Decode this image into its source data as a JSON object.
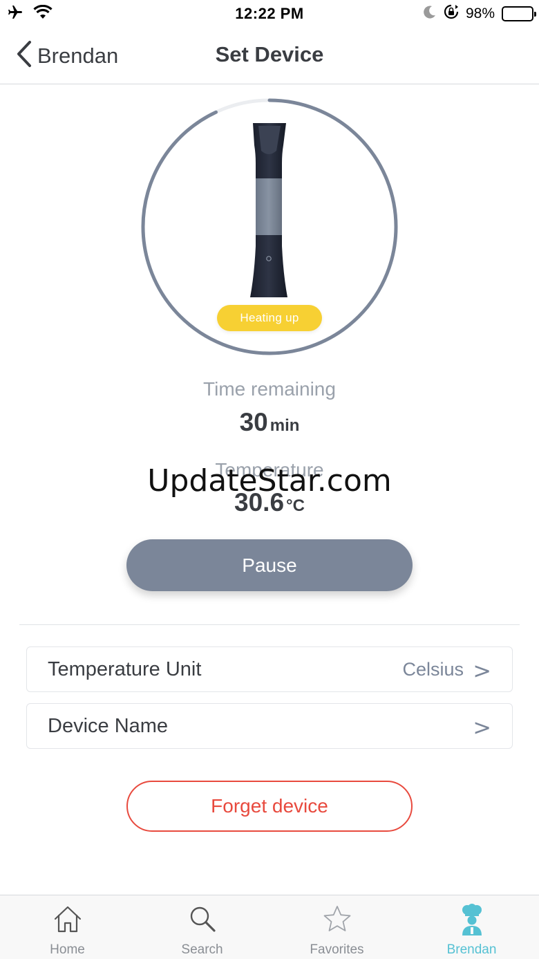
{
  "status_bar": {
    "time": "12:22 PM",
    "battery_percent": "98%",
    "icons": [
      "airplane-icon",
      "wifi-icon",
      "moon-icon",
      "rotation-lock-icon",
      "battery-icon"
    ]
  },
  "nav": {
    "back_label": "Brendan",
    "title": "Set Device"
  },
  "device": {
    "status_badge": "Heating up",
    "progress_fraction": 0.93
  },
  "stats": {
    "time_label": "Time remaining",
    "time_value": "30",
    "time_unit": "min",
    "temp_label": "Temperature",
    "temp_value": "30.6",
    "temp_unit": "°C"
  },
  "watermark": "UpdateStar.com",
  "actions": {
    "pause_label": "Pause",
    "forget_label": "Forget device"
  },
  "settings": [
    {
      "label": "Temperature Unit",
      "value": "Celsius",
      "chevron": ">"
    },
    {
      "label": "Device Name",
      "value": "",
      "chevron": ">"
    }
  ],
  "tabs": [
    {
      "label": "Home",
      "icon": "home-icon",
      "active": false
    },
    {
      "label": "Search",
      "icon": "search-icon",
      "active": false
    },
    {
      "label": "Favorites",
      "icon": "star-icon",
      "active": false
    },
    {
      "label": "Brendan",
      "icon": "chef-icon",
      "active": true
    }
  ],
  "colors": {
    "accent": "#55c1d3",
    "button_gray": "#7b8699",
    "danger": "#e84a3e",
    "badge_yellow": "#f7d033"
  }
}
